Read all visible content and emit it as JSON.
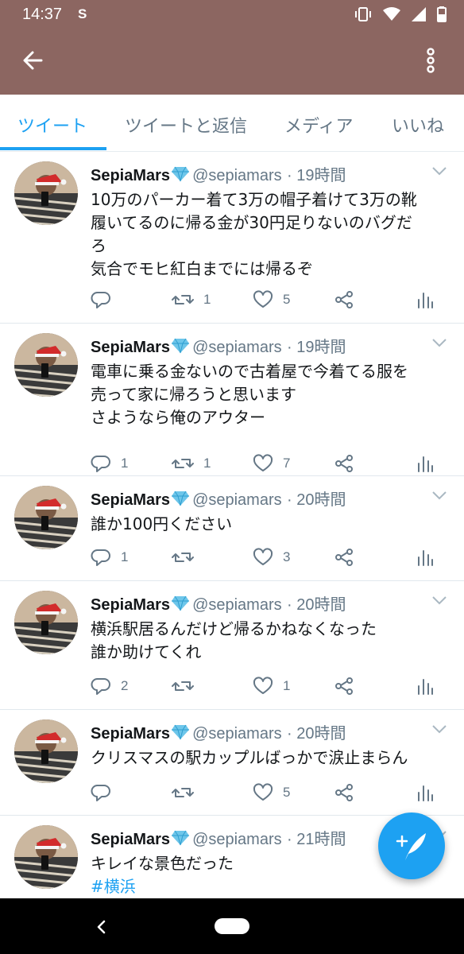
{
  "status": {
    "time": "14:37",
    "sim_label": "S"
  },
  "tabs": [
    {
      "label": "ツイート",
      "active": true
    },
    {
      "label": "ツイートと返信",
      "active": false
    },
    {
      "label": "メディア",
      "active": false
    },
    {
      "label": "いいね",
      "active": false
    }
  ],
  "tweets": [
    {
      "name": "SepiaMars",
      "handle": "@sepiamars",
      "time": "· 19時間",
      "lines": [
        "10万のパーカー着て3万の帽子着けて3万の靴",
        "履いてるのに帰る金が30円足りないのバグだ",
        "ろ",
        "気合でモヒ紅白までには帰るぞ"
      ],
      "replies": "",
      "retweets": "1",
      "likes": "5"
    },
    {
      "name": "SepiaMars",
      "handle": "@sepiamars",
      "time": "· 19時間",
      "lines": [
        "電車に乗る金ないので古着屋で今着てる服を",
        "売って家に帰ろうと思います",
        "さようなら俺のアウター"
      ],
      "replies": "1",
      "retweets": "1",
      "likes": "7"
    },
    {
      "name": "SepiaMars",
      "handle": "@sepiamars",
      "time": "· 20時間",
      "lines": [
        "誰か100円ください"
      ],
      "replies": "1",
      "retweets": "",
      "likes": "3"
    },
    {
      "name": "SepiaMars",
      "handle": "@sepiamars",
      "time": "· 20時間",
      "lines": [
        "横浜駅居るんだけど帰るかねなくなった",
        "誰か助けてくれ"
      ],
      "replies": "2",
      "retweets": "",
      "likes": "1"
    },
    {
      "name": "SepiaMars",
      "handle": "@sepiamars",
      "time": "· 20時間",
      "lines": [
        "クリスマスの駅カップルばっかで涙止まらん"
      ],
      "replies": "",
      "retweets": "",
      "likes": "5"
    },
    {
      "name": "SepiaMars",
      "handle": "@sepiamars",
      "time": "· 21時間",
      "lines": [
        "キレイな景色だった"
      ],
      "hashtag": "#横浜",
      "replies": "",
      "retweets": "",
      "likes": ""
    }
  ],
  "colors": {
    "appbar": "#8c6661",
    "accent": "#1da1f2",
    "muted": "#657786"
  },
  "icons": {
    "appbar": [
      "back-arrow-icon",
      "more-vert-icon"
    ],
    "actions": [
      "reply-icon",
      "retweet-icon",
      "like-icon",
      "share-icon",
      "analytics-icon"
    ],
    "fab": "compose-tweet-icon"
  }
}
